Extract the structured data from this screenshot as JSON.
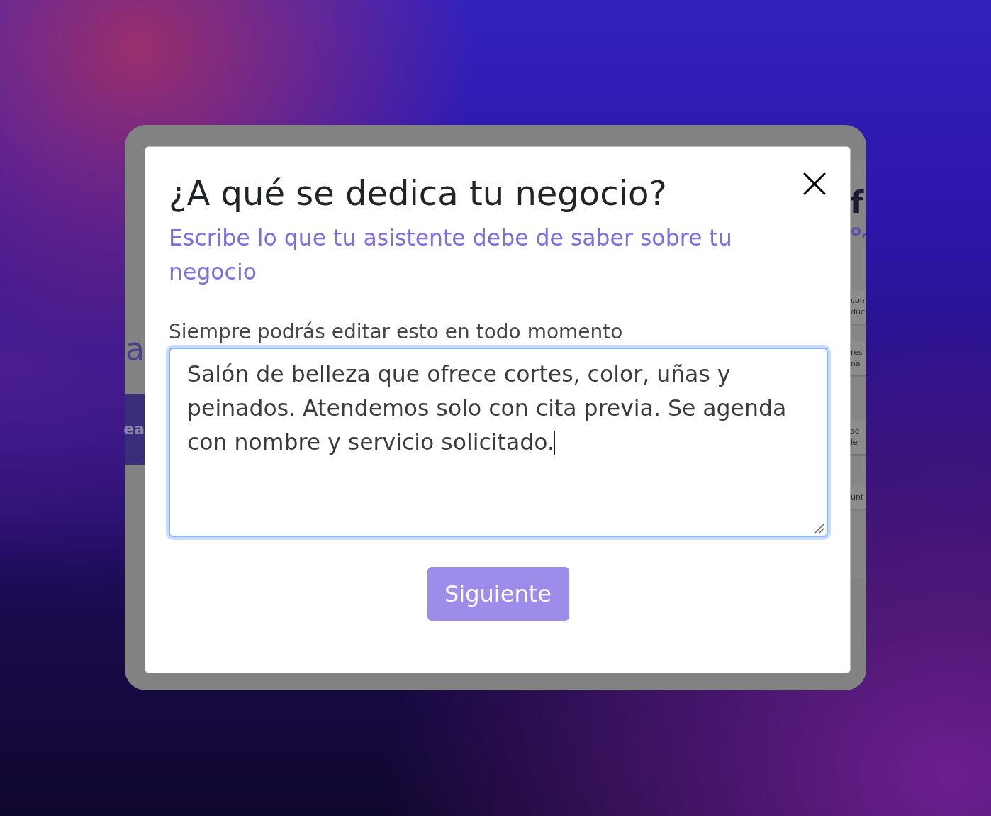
{
  "background_app": {
    "left_heading_fragment": "a",
    "left_banner_fragment": "ea",
    "right_title_fragment": "f",
    "right_subtitle_fragment": "o,",
    "right_cards": [
      {
        "lines": [
          "con",
          "duc"
        ]
      },
      {
        "lines": [
          "res",
          "na"
        ]
      },
      {
        "lines": [
          "se",
          "le"
        ]
      },
      {
        "lines": [
          "unt"
        ]
      }
    ]
  },
  "dialog": {
    "title": "¿A qué se dedica tu negocio?",
    "subtitle": "Escribe lo que tu asistente debe de saber sobre tu negocio",
    "field_label": "Siempre podrás editar esto en todo momento",
    "field": {
      "value": "Salón de belleza que ofrece cortes, color, uñas y peinados. Atendemos solo con cita previa. Se agenda con nombre y servicio solicitado.",
      "focused": true
    },
    "button": "Siguiente"
  }
}
